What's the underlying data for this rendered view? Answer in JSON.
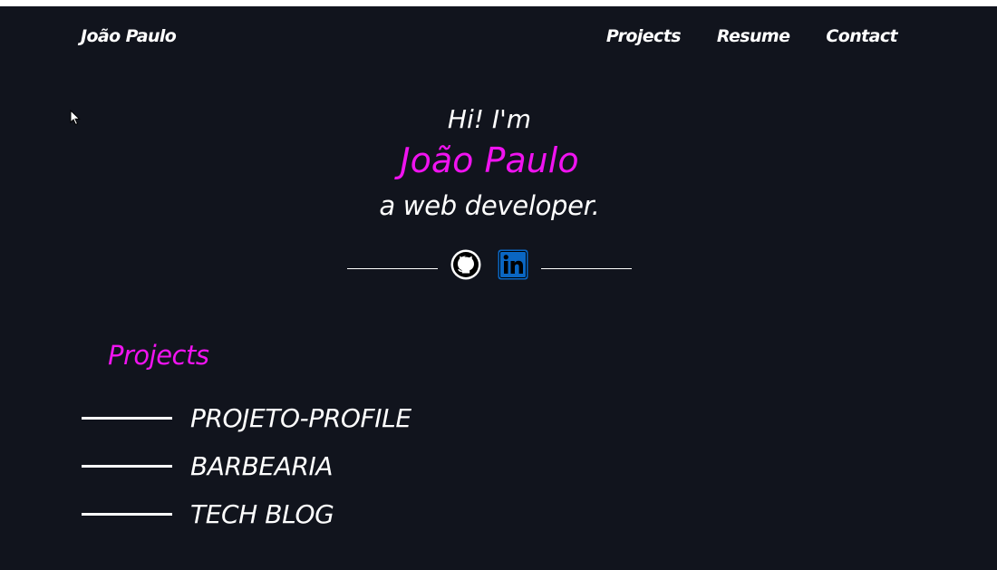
{
  "nav": {
    "brand": "João Paulo",
    "links": [
      "Projects",
      "Resume",
      "Contact"
    ]
  },
  "hero": {
    "greeting": "Hi! I'm",
    "name": "João Paulo",
    "role": "a web developer."
  },
  "social": {
    "icons": [
      "github-icon",
      "linkedin-icon"
    ]
  },
  "projects": {
    "title": "Projects",
    "items": [
      "PROJETO-PROFILE",
      "BARBEARIA",
      "TECH BLOG"
    ]
  },
  "colors": {
    "background": "#11141d",
    "accent": "#f013f0",
    "text": "#ffffff",
    "linkedin": "#0a66c2"
  }
}
